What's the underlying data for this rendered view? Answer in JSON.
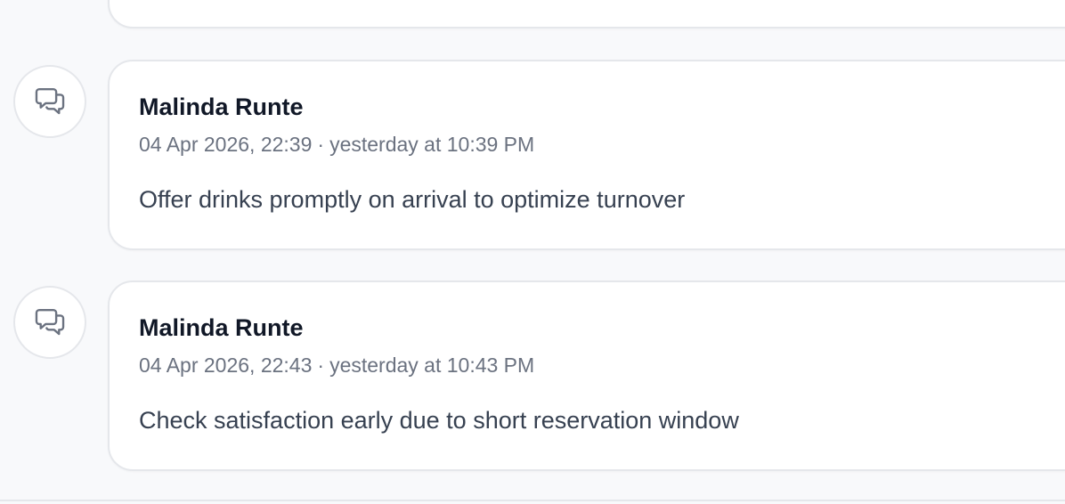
{
  "comments": [
    {
      "author": "Malinda Runte",
      "datetime": "04 Apr 2026, 22:39",
      "separator": "·",
      "relative": "yesterday at 10:39 PM",
      "text": "Offer drinks promptly on arrival to optimize turnover",
      "icon": "chat-bubbles-icon"
    },
    {
      "author": "Malinda Runte",
      "datetime": "04 Apr 2026, 22:43",
      "separator": "·",
      "relative": "yesterday at 10:43 PM",
      "text": "Check satisfaction early due to short reservation window",
      "icon": "chat-bubbles-icon"
    }
  ],
  "colors": {
    "background": "#f8f9fb",
    "card": "#ffffff",
    "border": "#e5e7eb",
    "author": "#111827",
    "meta": "#6b7280",
    "text": "#374151"
  }
}
